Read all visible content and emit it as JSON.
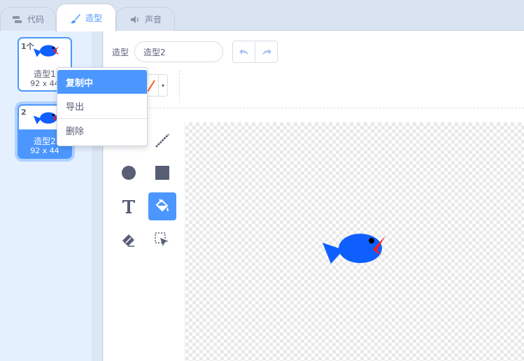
{
  "tabs": [
    {
      "label": "代码",
      "icon": "code-blocks-icon"
    },
    {
      "label": "造型",
      "icon": "paintbrush-icon"
    },
    {
      "label": "声音",
      "icon": "speaker-icon"
    }
  ],
  "active_tab": "造型",
  "costumes": [
    {
      "number": "1个",
      "name": "造型1",
      "size": "92 x 44",
      "thumbnail": "fish-icon"
    },
    {
      "number": "2",
      "name": "造型2",
      "size": "92 x 44",
      "thumbnail": "fish-icon",
      "selected": true
    }
  ],
  "context_menu": {
    "items": [
      "复制中",
      "导出",
      "删除"
    ],
    "highlighted": "复制中"
  },
  "editor": {
    "costume_label": "造型",
    "costume_name": "造型2",
    "undo_icon": "undo-icon",
    "redo_icon": "redo-icon",
    "outline_color_swatch": "red-slash-swatch",
    "tools": [
      "circle-tool-icon",
      "rectangle-tool-icon",
      "text-tool-icon",
      "fill-bucket-icon",
      "eraser-icon",
      "select-icon",
      "line-tool-icon"
    ],
    "active_tool": "fill-bucket-icon"
  },
  "colors": {
    "accent": "#4c97ff",
    "fish_body": "#0f5fff",
    "fish_mouth": "#ff1a1a"
  }
}
